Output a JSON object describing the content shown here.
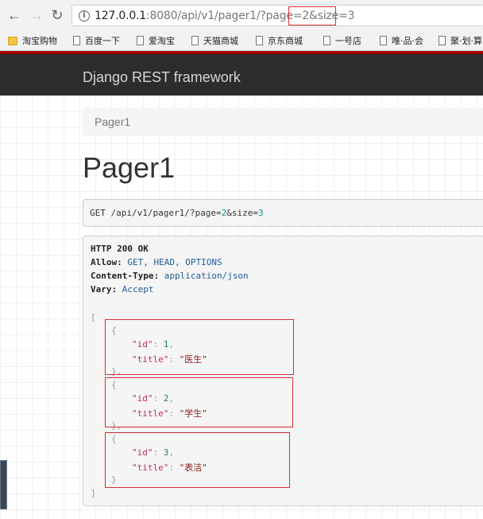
{
  "browser": {
    "back_glyph": "←",
    "forward_glyph": "→",
    "reload_glyph": "↻",
    "info_glyph": "i",
    "url_host": "127.0.0.1",
    "url_rest": ":8080/api/v1/pager1/?page=2&size=3",
    "bookmarks": [
      {
        "label": "淘宝购物",
        "icon": "folder-icon"
      },
      {
        "label": "百度一下",
        "icon": "page-icon"
      },
      {
        "label": "爱淘宝",
        "icon": "page-icon"
      },
      {
        "label": "天猫商城",
        "icon": "page-icon"
      },
      {
        "label": "京东商城",
        "icon": "page-icon"
      },
      {
        "label": "一号店",
        "icon": "page-icon"
      },
      {
        "label": "唯·品·会",
        "icon": "page-icon"
      },
      {
        "label": "聚·划·算",
        "icon": "page-icon"
      }
    ]
  },
  "navbar": {
    "brand": "Django REST framework"
  },
  "breadcrumb": {
    "current": "Pager1"
  },
  "page": {
    "title": "Pager1"
  },
  "request": {
    "method": "GET",
    "path": "/api/v1/pager1/?page=",
    "page_val": "2",
    "amp": "&size=",
    "size_val": "3"
  },
  "response": {
    "status": "HTTP 200 OK",
    "headers": [
      {
        "name": "Allow:",
        "value": "GET, HEAD, OPTIONS"
      },
      {
        "name": "Content-Type:",
        "value": "application/json"
      },
      {
        "name": "Vary:",
        "value": "Accept"
      }
    ],
    "open_bracket": "[",
    "close_bracket": "]",
    "items": [
      {
        "id": "1",
        "title": "\"医生\""
      },
      {
        "id": "2",
        "title": "\"学生\""
      },
      {
        "id": "3",
        "title": "\"表洁\""
      }
    ],
    "key_id": "\"id\"",
    "key_title": "\"title\""
  },
  "colors": {
    "highlight": "#d92c2c",
    "navbar": "#2c2c2c",
    "navbar_accent": "#a30000"
  }
}
